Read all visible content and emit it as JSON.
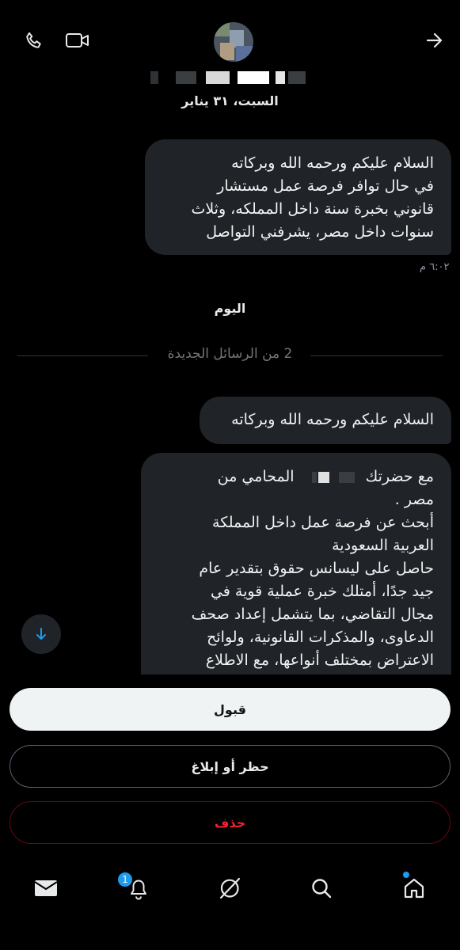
{
  "header": {
    "call_icon": "phone-icon",
    "video_icon": "video-camera-icon",
    "forward_icon": "arrow-right-icon"
  },
  "conversation": {
    "date_label": "السبت، ٣١ يناير",
    "message_1": {
      "lines": [
        "السلام عليكم ورحمه الله وبركاته",
        "في حال توافر فرصة عمل مستشار",
        "قانوني بخبرة سنة داخل المملكه، وثلاث",
        "سنوات داخل مصر، يشرفني التواصل"
      ],
      "time": "٦:٠٢ م"
    },
    "today_label": "اليوم",
    "new_messages_divider": "2 من الرسائل الجديدة",
    "message_2": {
      "lines": [
        "السلام عليكم ورحمه الله وبركاته"
      ]
    },
    "message_3": {
      "line_1_start": "مع حضرتك",
      "line_1_end": "المحامي من",
      "lines": [
        "مصر .",
        " أبحث عن فرصة عمل داخل المملكة",
        "العربية السعودية",
        "حاصل على ليسانس حقوق بتقدير عام",
        "جيد جدًا، أمتلك خبرة عملية قوية في",
        "مجال التقاضي، بما يتشمل إعداد صحف",
        "الدعاوى، والمذكرات القانونية، ولوائح",
        "الاعتراض بمختلف أنواعها، مع الاطلاع"
      ]
    }
  },
  "actions": {
    "accept": "قبول",
    "block_report": "حظر أو إبلاغ",
    "delete": "حذف"
  },
  "bottom_nav": {
    "items": [
      "mail-icon",
      "bell-icon",
      "grok-icon",
      "search-icon",
      "home-icon"
    ],
    "notification_count": "1"
  },
  "colors": {
    "background": "#000000",
    "bubble": "#202327",
    "accent": "#1d9bf0",
    "danger": "#f4212e"
  }
}
